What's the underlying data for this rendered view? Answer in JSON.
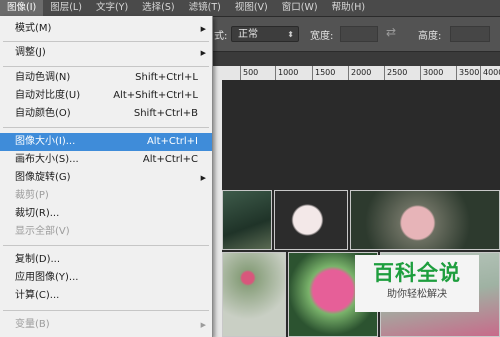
{
  "menubar": {
    "items": [
      "图像(I)",
      "图层(L)",
      "文字(Y)",
      "选择(S)",
      "滤镜(T)",
      "视图(V)",
      "窗口(W)",
      "帮助(H)"
    ]
  },
  "options_bar": {
    "style_label": "式:",
    "style_value": "正常",
    "width_label": "宽度:",
    "height_label": "高度:"
  },
  "ruler": {
    "ticks": [
      "500",
      "1000",
      "1500",
      "2000",
      "2500",
      "3000",
      "3500",
      "4000"
    ]
  },
  "menu": {
    "items": [
      {
        "label": "模式(M)",
        "submenu": true
      },
      {
        "label": "调整(J)",
        "submenu": true
      },
      {
        "label": "自动色调(N)",
        "shortcut": "Shift+Ctrl+L"
      },
      {
        "label": "自动对比度(U)",
        "shortcut": "Alt+Shift+Ctrl+L"
      },
      {
        "label": "自动颜色(O)",
        "shortcut": "Shift+Ctrl+B"
      },
      {
        "label": "图像大小(I)...",
        "shortcut": "Alt+Ctrl+I",
        "highlighted": true
      },
      {
        "label": "画布大小(S)...",
        "shortcut": "Alt+Ctrl+C"
      },
      {
        "label": "图像旋转(G)",
        "submenu": true
      },
      {
        "label": "裁剪(P)",
        "disabled": true
      },
      {
        "label": "裁切(R)..."
      },
      {
        "label": "显示全部(V)",
        "disabled": true
      },
      {
        "label": "复制(D)..."
      },
      {
        "label": "应用图像(Y)..."
      },
      {
        "label": "计算(C)..."
      },
      {
        "label": "变量(B)",
        "submenu": true,
        "disabled": true
      }
    ]
  },
  "watermark": {
    "title": "百科全说",
    "subtitle": "助你轻松解决"
  },
  "colors": {
    "highlight": "#3f8cd9",
    "watermark_green": "#1e9e3e"
  }
}
